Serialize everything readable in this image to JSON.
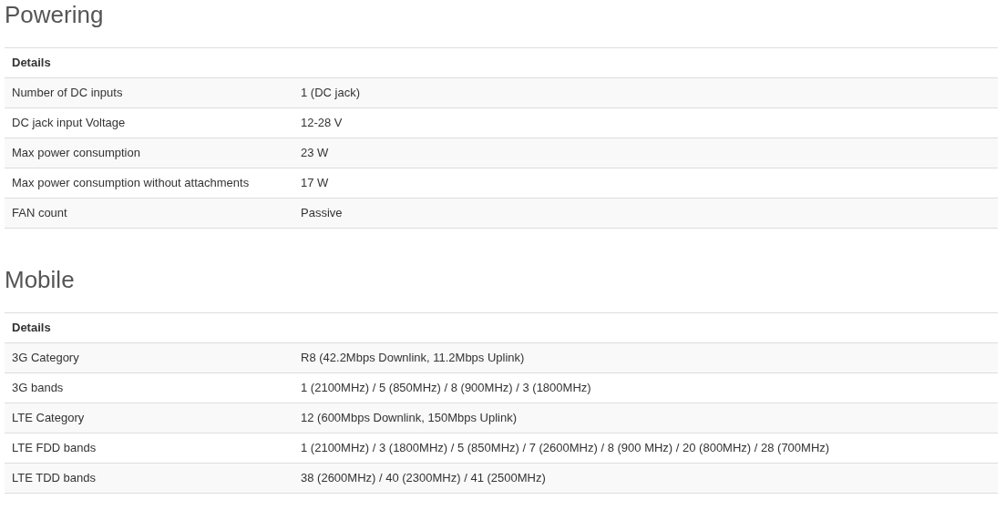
{
  "sections": [
    {
      "title": "Powering",
      "header": "Details",
      "rows": [
        {
          "label": "Number of DC inputs",
          "value": "1 (DC jack)"
        },
        {
          "label": "DC jack input Voltage",
          "value": "12-28 V"
        },
        {
          "label": "Max power consumption",
          "value": "23 W"
        },
        {
          "label": "Max power consumption without attachments",
          "value": "17 W"
        },
        {
          "label": "FAN count",
          "value": "Passive"
        }
      ]
    },
    {
      "title": "Mobile",
      "header": "Details",
      "rows": [
        {
          "label": "3G Category",
          "value": "R8 (42.2Mbps Downlink, 11.2Mbps Uplink)"
        },
        {
          "label": "3G bands",
          "value": "1 (2100MHz) / 5 (850MHz) / 8 (900MHz) / 3 (1800MHz)"
        },
        {
          "label": "LTE Category",
          "value": "12 (600Mbps Downlink, 150Mbps Uplink)"
        },
        {
          "label": "LTE FDD bands",
          "value": "1 (2100MHz) / 3 (1800MHz) / 5 (850MHz) / 7 (2600MHz) / 8 (900 MHz) / 20 (800MHz) / 28 (700MHz)"
        },
        {
          "label": "LTE TDD bands",
          "value": "38 (2600MHz) / 40 (2300MHz) / 41 (2500MHz)"
        }
      ]
    }
  ]
}
